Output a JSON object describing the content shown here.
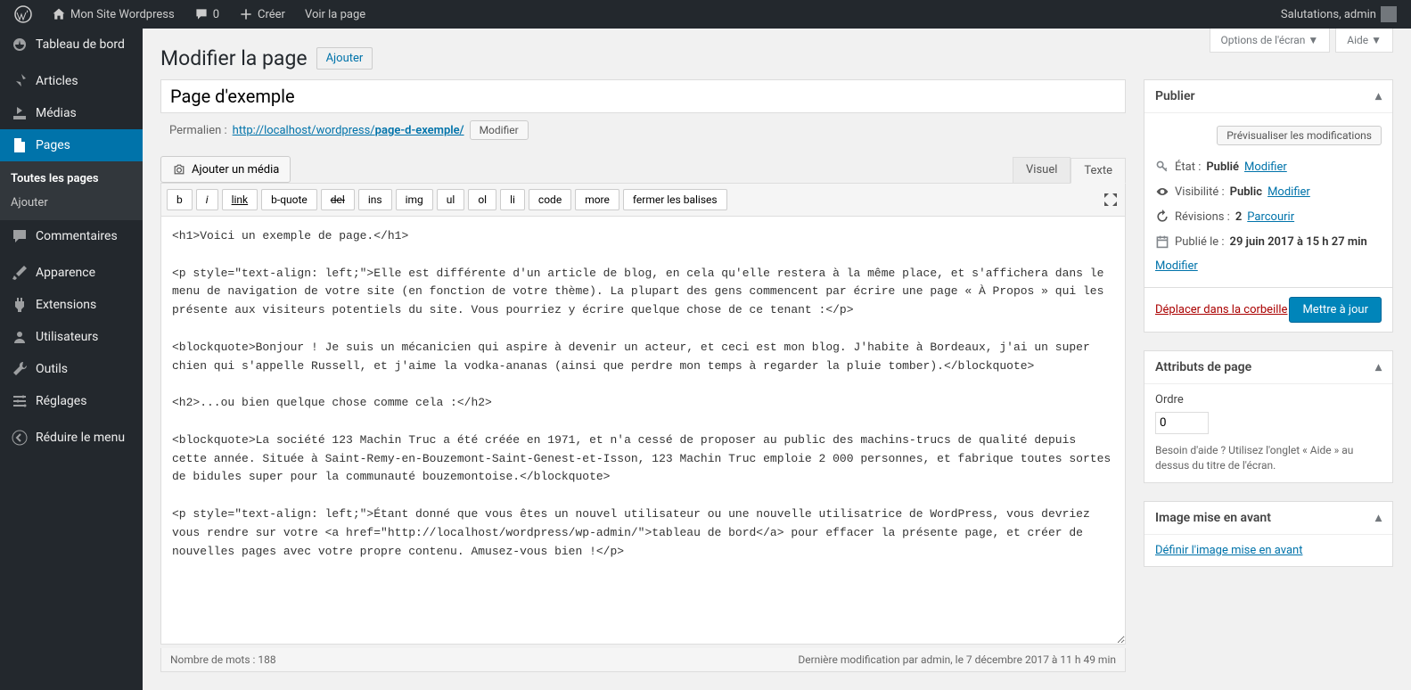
{
  "toolbar": {
    "site_name": "Mon Site Wordpress",
    "comments_count": "0",
    "create_label": "Créer",
    "view_label": "Voir la page",
    "greeting": "Salutations, admin"
  },
  "sidebar": {
    "items": [
      {
        "label": "Tableau de bord"
      },
      {
        "label": "Articles"
      },
      {
        "label": "Médias"
      },
      {
        "label": "Pages"
      },
      {
        "label": "Commentaires"
      },
      {
        "label": "Apparence"
      },
      {
        "label": "Extensions"
      },
      {
        "label": "Utilisateurs"
      },
      {
        "label": "Outils"
      },
      {
        "label": "Réglages"
      },
      {
        "label": "Réduire le menu"
      }
    ],
    "submenu": [
      {
        "label": "Toutes les pages"
      },
      {
        "label": "Ajouter"
      }
    ]
  },
  "topright": {
    "screen_options": "Options de l'écran",
    "help": "Aide"
  },
  "heading": {
    "title": "Modifier la page",
    "add_new": "Ajouter"
  },
  "title_field": {
    "value": "Page d'exemple"
  },
  "permalink": {
    "label": "Permalien :",
    "base_url": "http://localhost/wordpress/",
    "slug": "page-d-exemple/",
    "edit": "Modifier"
  },
  "media_button": "Ajouter un média",
  "editor_tabs": {
    "visual": "Visuel",
    "text": "Texte"
  },
  "quicktags": [
    "b",
    "i",
    "link",
    "b-quote",
    "del",
    "ins",
    "img",
    "ul",
    "ol",
    "li",
    "code",
    "more",
    "fermer les balises"
  ],
  "editor_content": "<h1>Voici un exemple de page.</h1>\n\n<p style=\"text-align: left;\">Elle est différente d'un article de blog, en cela qu'elle restera à la même place, et s'affichera dans le menu de navigation de votre site (en fonction de votre thème). La plupart des gens commencent par écrire une page « À Propos » qui les présente aux visiteurs potentiels du site. Vous pourriez y écrire quelque chose de ce tenant :</p>\n\n<blockquote>Bonjour ! Je suis un mécanicien qui aspire à devenir un acteur, et ceci est mon blog. J'habite à Bordeaux, j'ai un super chien qui s'appelle Russell, et j'aime la vodka-ananas (ainsi que perdre mon temps à regarder la pluie tomber).</blockquote>\n\n<h2>...ou bien quelque chose comme cela :</h2>\n\n<blockquote>La société 123 Machin Truc a été créée en 1971, et n'a cessé de proposer au public des machins-trucs de qualité depuis cette année. Située à Saint-Remy-en-Bouzemont-Saint-Genest-et-Isson, 123 Machin Truc emploie 2 000 personnes, et fabrique toutes sortes de bidules super pour la communauté bouzemontoise.</blockquote>\n\n<p style=\"text-align: left;\">Étant donné que vous êtes un nouvel utilisateur ou une nouvelle utilisatrice de WordPress, vous devriez vous rendre sur votre <a href=\"http://localhost/wordpress/wp-admin/\">tableau de bord</a> pour effacer la présente page, et créer de nouvelles pages avec votre propre contenu. Amusez-vous bien !</p>",
  "editor_footer": {
    "word_count": "Nombre de mots : 188",
    "last_modified": "Dernière modification par admin, le 7 décembre 2017 à 11 h 49 min"
  },
  "publish": {
    "box_title": "Publier",
    "preview": "Prévisualiser les modifications",
    "status_label": "État :",
    "status_value": "Publié",
    "status_edit": "Modifier",
    "visibility_label": "Visibilité :",
    "visibility_value": "Public",
    "visibility_edit": "Modifier",
    "revisions_label": "Révisions :",
    "revisions_value": "2",
    "revisions_browse": "Parcourir",
    "published_label": "Publié le :",
    "published_value": "29 juin 2017 à 15 h 27 min",
    "published_edit": "Modifier",
    "trash": "Déplacer dans la corbeille",
    "update": "Mettre à jour"
  },
  "page_attrs": {
    "box_title": "Attributs de page",
    "order_label": "Ordre",
    "order_value": "0",
    "help_text": "Besoin d'aide ? Utilisez l'onglet « Aide » au dessus du titre de l'écran."
  },
  "featured": {
    "box_title": "Image mise en avant",
    "set_link": "Définir l'image mise en avant"
  }
}
